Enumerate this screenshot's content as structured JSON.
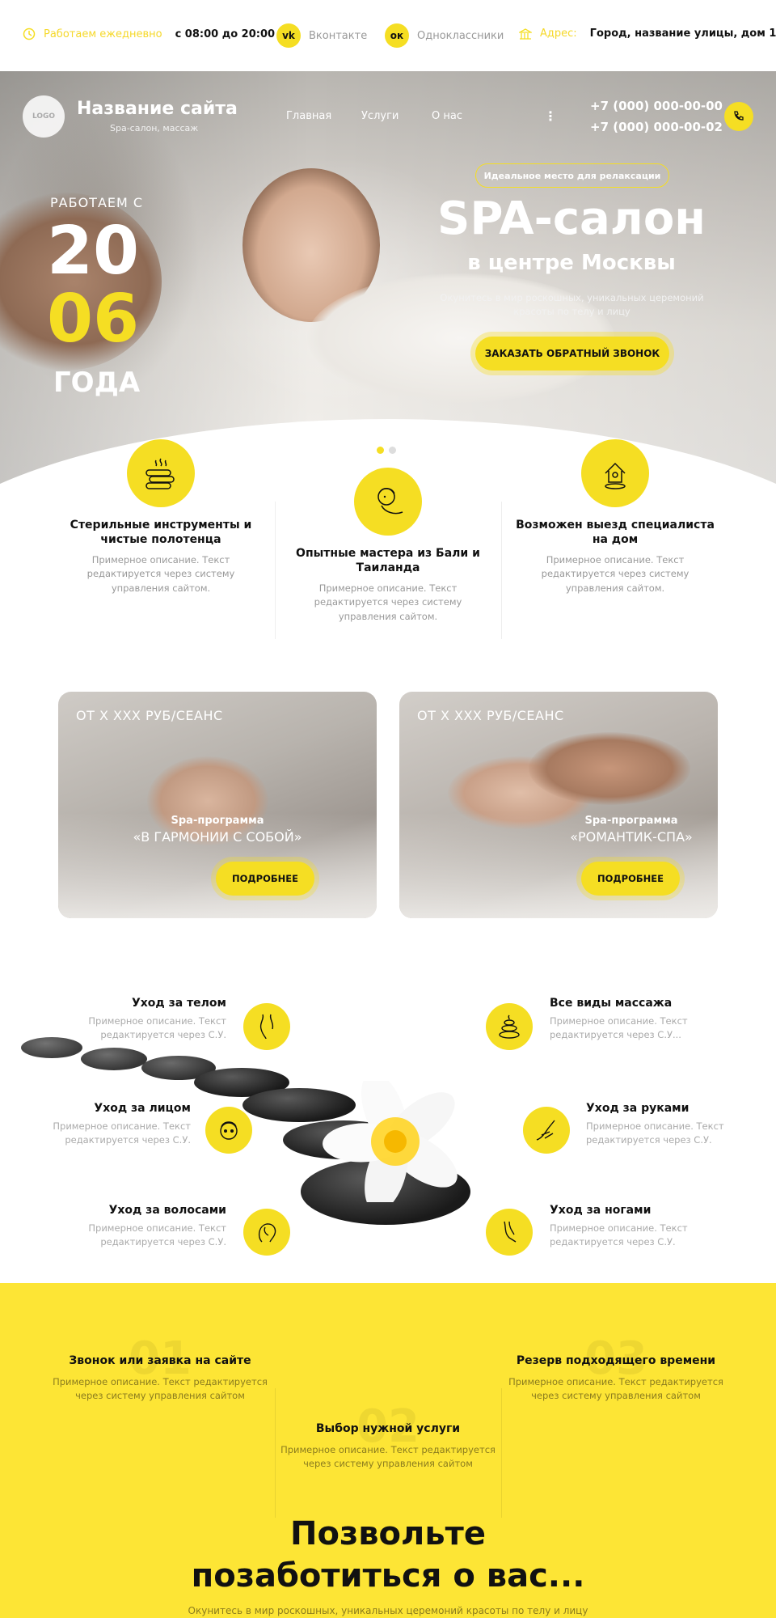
{
  "topbar": {
    "hours_label": "Работаем ежедневно",
    "hours_value": "с 08:00 до 20:00",
    "vk_label": "Вконтакте",
    "ok_label": "Одноклассники",
    "address_label": "Адрес:",
    "address_value": "Город, название улицы, дом 1",
    "vk_icon": "vk-icon",
    "ok_icon": "odnoklassniki-icon"
  },
  "header": {
    "logo": "LOGO",
    "site_title": "Название сайта",
    "site_sub": "Spa-салон, массаж",
    "nav": [
      "Главная",
      "Услуги",
      "О нас"
    ],
    "phones": [
      "+7 (000) 000-00-00",
      "+7 (000) 000-00-02"
    ]
  },
  "hero": {
    "since": "РАБОТАЕМ С",
    "year1": "20",
    "year2": "06",
    "years_word": "ГОДА",
    "badge": "Идеальное место для релаксации",
    "title": "SPA-салон",
    "subtitle": "в центре Москвы",
    "description": "Окунитесь в мир роскошных, уникальных церемоний красоты по телу и лицу",
    "cta": "ЗАКАЗАТЬ ОБРАТНЫЙ ЗВОНОК"
  },
  "features": [
    {
      "title": "Стерильные инструменты и чистые полотенца",
      "text": "Примерное описание. Текст редактируется через систему управления сайтом.",
      "icon": "towels-icon"
    },
    {
      "title": "Опытные мастера из Бали и Таиланда",
      "text": "Примерное описание. Текст редактируется через систему управления сайтом.",
      "icon": "face-mask-icon"
    },
    {
      "title": "Возможен выезд специалиста на дом",
      "text": "Примерное описание. Текст редактируется через систему управления сайтом.",
      "icon": "home-location-icon"
    }
  ],
  "programs": [
    {
      "price": "ОТ Х ХХХ РУБ/СЕАНС",
      "label": "Spa-программа",
      "name": "«В ГАРМОНИИ С СОБОЙ»",
      "button": "ПОДРОБНЕЕ"
    },
    {
      "price": "ОТ Х ХХХ РУБ/СЕАНС",
      "label": "Spa-программа",
      "name": "«РОМАНТИК-СПА»",
      "button": "ПОДРОБНЕЕ"
    }
  ],
  "services": [
    {
      "title": "Уход за телом",
      "text": "Примерное описание. Текст редактируется через С.У."
    },
    {
      "title": "Уход за лицом",
      "text": "Примерное описание. Текст редактируется через С.У."
    },
    {
      "title": "Уход за волосами",
      "text": "Примерное описание. Текст редактируется через С.У."
    },
    {
      "title": "Все виды массажа",
      "text": "Примерное описание. Текст редактируется через С.У..."
    },
    {
      "title": "Уход за руками",
      "text": "Примерное описание. Текст редактируется через С.У."
    },
    {
      "title": "Уход за ногами",
      "text": "Примерное описание. Текст редактируется через С.У."
    }
  ],
  "steps": [
    {
      "num": "01",
      "title": "Звонок или заявка на сайте",
      "text": "Примерное описание. Текст редактируется через систему управления сайтом"
    },
    {
      "num": "02",
      "title": "Выбор нужной услуги",
      "text": "Примерное описание. Текст редактируется через систему управления сайтом"
    },
    {
      "num": "03",
      "title": "Резерв подходящего времени",
      "text": "Примерное описание. Текст редактируется через систему управления сайтом"
    }
  ],
  "care": {
    "title_line1": "Позвольте",
    "title_line2": "позаботиться о вас...",
    "sub": "Окунитесь в мир роскошных, уникальных церемоний красоты по телу и лицу"
  },
  "colors": {
    "accent": "#f5de23",
    "steps_bg": "#fde535"
  }
}
